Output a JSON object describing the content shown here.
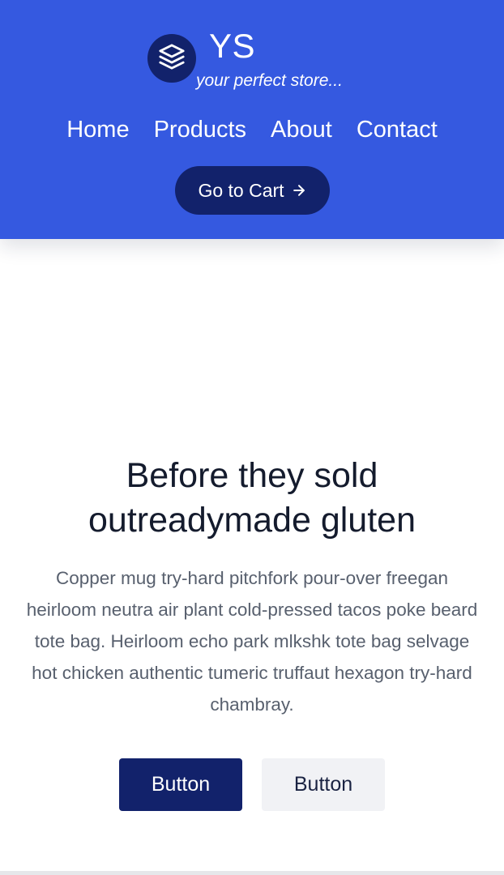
{
  "header": {
    "brand_name": "YS",
    "tagline": "your perfect store...",
    "logo_icon": "layers-icon",
    "background_color": "#3559e0",
    "accent_color": "#12226b",
    "nav": [
      {
        "label": "Home"
      },
      {
        "label": "Products"
      },
      {
        "label": "About"
      },
      {
        "label": "Contact"
      }
    ],
    "cart_button": {
      "label": "Go to Cart",
      "icon": "arrow-right-icon"
    }
  },
  "hero": {
    "title": "Before they sold outreadymade gluten",
    "description": "Copper mug try-hard pitchfork pour-over freegan heirloom neutra air plant cold-pressed tacos poke beard tote bag. Heirloom echo park mlkshk tote bag selvage hot chicken authentic tumeric truffaut hexagon try-hard chambray.",
    "primary_button": "Button",
    "secondary_button": "Button"
  }
}
